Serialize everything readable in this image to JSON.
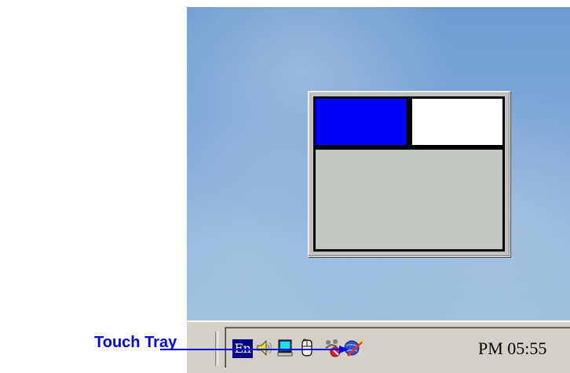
{
  "annotation": {
    "label": "Touch Tray",
    "color": "#0000e0"
  },
  "popup": {
    "left_button_color": "#0000ff",
    "right_button_color": "#ffffff",
    "pad_color": "#c0c6c0"
  },
  "taskbar": {
    "tray_icons": [
      {
        "name": "language-indicator-icon",
        "text": "En"
      },
      {
        "name": "speaker-icon"
      },
      {
        "name": "monitor-icon"
      },
      {
        "name": "mouse-touch-tray-icon"
      },
      {
        "name": "network-disconnected-icon"
      },
      {
        "name": "globe-pen-icon"
      }
    ],
    "clock": "PM 05:55"
  }
}
